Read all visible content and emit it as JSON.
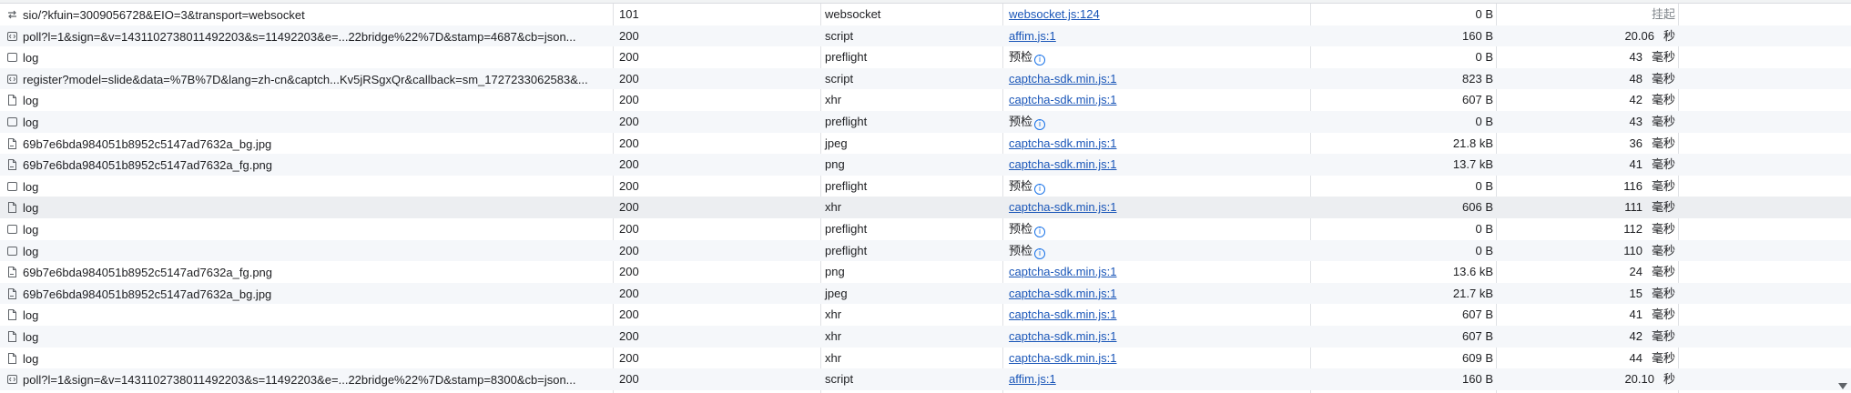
{
  "rows": [
    {
      "name": "sio/?kfuin=3009056728&EIO=3&transport=websocket",
      "icon": "websocket-icon",
      "status": "101",
      "type": "websocket",
      "initiator": "websocket.js:124",
      "initiator_link": true,
      "size": "0 B",
      "time": "挂起",
      "time_unit": ""
    },
    {
      "name": "poll?l=1&sign=&v=1431102738011492203&s=11492203&e=...22bridge%22%7D&stamp=4687&cb=json...",
      "icon": "script-icon",
      "status": "200",
      "type": "script",
      "initiator": "affim.js:1",
      "initiator_link": true,
      "size": "160 B",
      "time": "20.06",
      "time_unit": "秒"
    },
    {
      "name": "log",
      "icon": "preflight-icon",
      "status": "200",
      "type": "preflight",
      "initiator": "预检",
      "initiator_link": false,
      "size": "0 B",
      "time": "43",
      "time_unit": "毫秒"
    },
    {
      "name": "register?model=slide&data=%7B%7D&lang=zh-cn&captch...Kv5jRSgxQr&callback=sm_1727233062583&...",
      "icon": "script-icon",
      "status": "200",
      "type": "script",
      "initiator": "captcha-sdk.min.js:1",
      "initiator_link": true,
      "size": "823 B",
      "time": "48",
      "time_unit": "毫秒"
    },
    {
      "name": "log",
      "icon": "document-icon",
      "status": "200",
      "type": "xhr",
      "initiator": "captcha-sdk.min.js:1",
      "initiator_link": true,
      "size": "607 B",
      "time": "42",
      "time_unit": "毫秒"
    },
    {
      "name": "log",
      "icon": "preflight-icon",
      "status": "200",
      "type": "preflight",
      "initiator": "预检",
      "initiator_link": false,
      "size": "0 B",
      "time": "43",
      "time_unit": "毫秒"
    },
    {
      "name": "69b7e6bda984051b8952c5147ad7632a_bg.jpg",
      "icon": "image-icon",
      "status": "200",
      "type": "jpeg",
      "initiator": "captcha-sdk.min.js:1",
      "initiator_link": true,
      "size": "21.8 kB",
      "time": "36",
      "time_unit": "毫秒"
    },
    {
      "name": "69b7e6bda984051b8952c5147ad7632a_fg.png",
      "icon": "image-icon",
      "status": "200",
      "type": "png",
      "initiator": "captcha-sdk.min.js:1",
      "initiator_link": true,
      "size": "13.7 kB",
      "time": "41",
      "time_unit": "毫秒"
    },
    {
      "name": "log",
      "icon": "preflight-icon",
      "status": "200",
      "type": "preflight",
      "initiator": "预检",
      "initiator_link": false,
      "size": "0 B",
      "time": "116",
      "time_unit": "毫秒"
    },
    {
      "name": "log",
      "icon": "document-icon",
      "status": "200",
      "type": "xhr",
      "initiator": "captcha-sdk.min.js:1",
      "initiator_link": true,
      "size": "606 B",
      "time": "111",
      "time_unit": "毫秒"
    },
    {
      "name": "log",
      "icon": "preflight-icon",
      "status": "200",
      "type": "preflight",
      "initiator": "预检",
      "initiator_link": false,
      "size": "0 B",
      "time": "112",
      "time_unit": "毫秒"
    },
    {
      "name": "log",
      "icon": "preflight-icon",
      "status": "200",
      "type": "preflight",
      "initiator": "预检",
      "initiator_link": false,
      "size": "0 B",
      "time": "110",
      "time_unit": "毫秒"
    },
    {
      "name": "69b7e6bda984051b8952c5147ad7632a_fg.png",
      "icon": "image-icon",
      "status": "200",
      "type": "png",
      "initiator": "captcha-sdk.min.js:1",
      "initiator_link": true,
      "size": "13.6 kB",
      "time": "24",
      "time_unit": "毫秒"
    },
    {
      "name": "69b7e6bda984051b8952c5147ad7632a_bg.jpg",
      "icon": "image-icon",
      "status": "200",
      "type": "jpeg",
      "initiator": "captcha-sdk.min.js:1",
      "initiator_link": true,
      "size": "21.7 kB",
      "time": "15",
      "time_unit": "毫秒"
    },
    {
      "name": "log",
      "icon": "document-icon",
      "status": "200",
      "type": "xhr",
      "initiator": "captcha-sdk.min.js:1",
      "initiator_link": true,
      "size": "607 B",
      "time": "41",
      "time_unit": "毫秒"
    },
    {
      "name": "log",
      "icon": "document-icon",
      "status": "200",
      "type": "xhr",
      "initiator": "captcha-sdk.min.js:1",
      "initiator_link": true,
      "size": "607 B",
      "time": "42",
      "time_unit": "毫秒"
    },
    {
      "name": "log",
      "icon": "document-icon",
      "status": "200",
      "type": "xhr",
      "initiator": "captcha-sdk.min.js:1",
      "initiator_link": true,
      "size": "609 B",
      "time": "44",
      "time_unit": "毫秒"
    },
    {
      "name": "poll?l=1&sign=&v=1431102738011492203&s=11492203&e=...22bridge%22%7D&stamp=8300&cb=json...",
      "icon": "script-icon",
      "status": "200",
      "type": "script",
      "initiator": "affim.js:1",
      "initiator_link": true,
      "size": "160 B",
      "time": "20.10",
      "time_unit": "秒"
    }
  ],
  "hovered_row": 9,
  "info_badge_glyph": "i",
  "colors": {
    "link": "#1a56b8",
    "badge": "#1a73e8"
  }
}
